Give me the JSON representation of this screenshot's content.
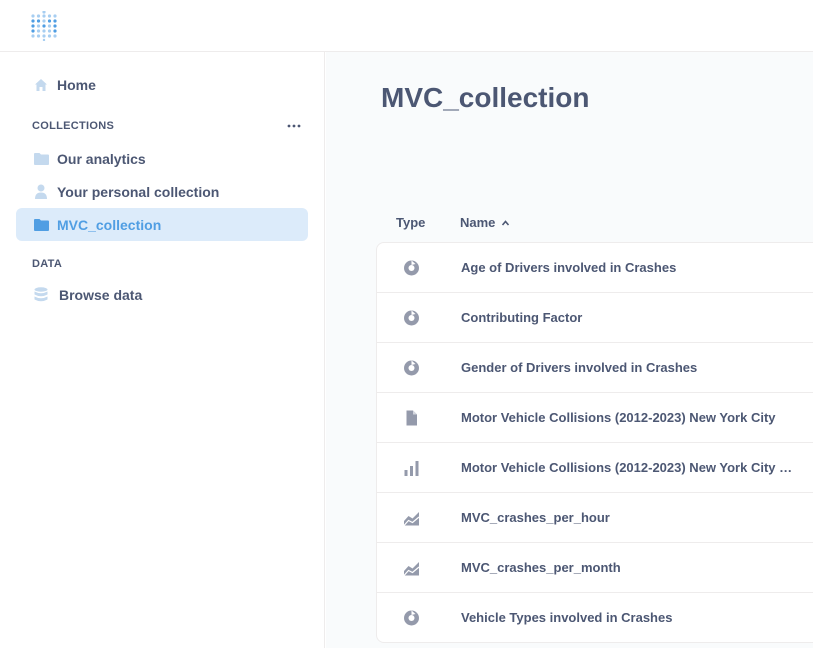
{
  "sidebar": {
    "home_label": "Home",
    "collections_heading": "COLLECTIONS",
    "collections": [
      {
        "label": "Our analytics",
        "icon": "folder-icon"
      },
      {
        "label": "Your personal collection",
        "icon": "person-icon"
      },
      {
        "label": "MVC_collection",
        "icon": "folder-icon",
        "active": true
      }
    ],
    "data_heading": "DATA",
    "browse_label": "Browse data",
    "more_icon": "more-icon"
  },
  "main": {
    "title": "MVC_collection",
    "columns": {
      "type": "Type",
      "name": "Name"
    },
    "sort_indicator": "ascending",
    "items": [
      {
        "type_icon": "pie-chart-icon",
        "name": "Age of Drivers involved in Crashes"
      },
      {
        "type_icon": "pie-chart-icon",
        "name": "Contributing Factor"
      },
      {
        "type_icon": "pie-chart-icon",
        "name": "Gender of Drivers involved in Crashes"
      },
      {
        "type_icon": "document-icon",
        "name": "Motor Vehicle Collisions (2012-2023) New York City"
      },
      {
        "type_icon": "bar-chart-icon",
        "name": "Motor Vehicle Collisions (2012-2023) New York City …"
      },
      {
        "type_icon": "area-chart-icon",
        "name": "MVC_crashes_per_hour"
      },
      {
        "type_icon": "area-chart-icon",
        "name": "MVC_crashes_per_month"
      },
      {
        "type_icon": "pie-chart-icon",
        "name": "Vehicle Types involved in Crashes"
      }
    ]
  },
  "colors": {
    "brand": "#509ee3",
    "active_bg": "#dcebfa",
    "text": "#4c5773",
    "icon_muted": "#949aab",
    "border": "#eeecec"
  }
}
